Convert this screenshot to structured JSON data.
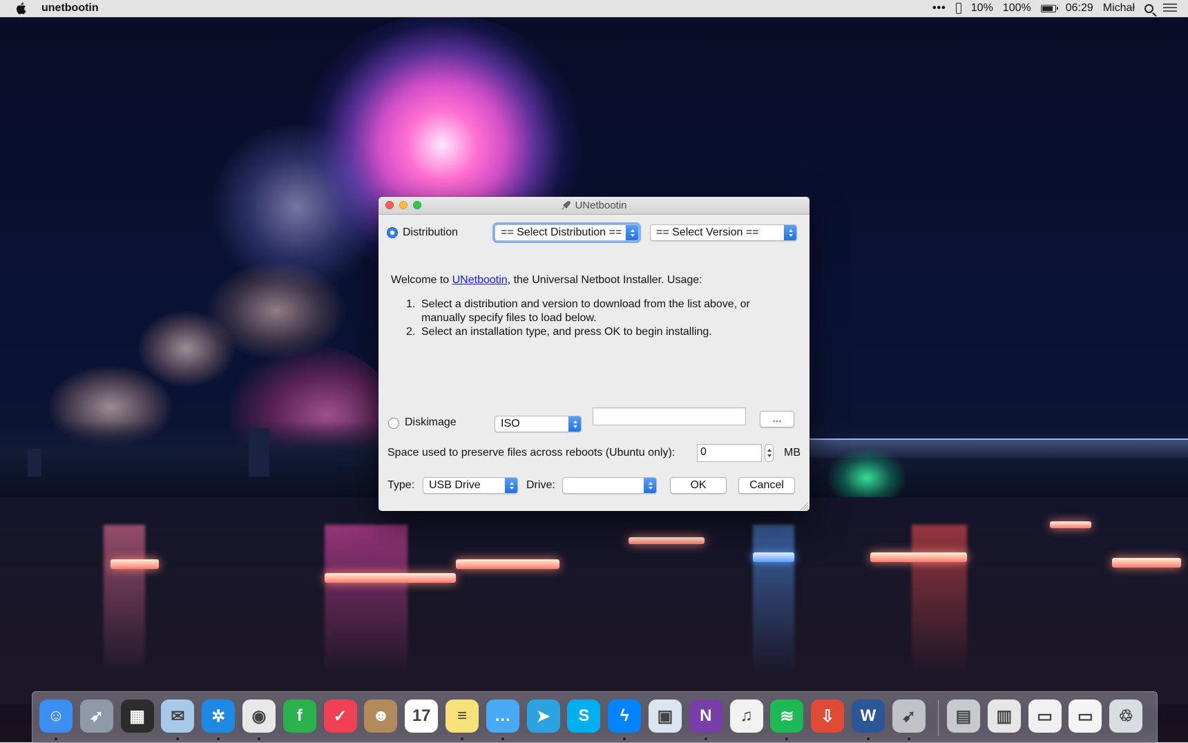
{
  "menubar": {
    "app_name": "unetbootin",
    "ellipsis": "•••",
    "phone_battery": "10%",
    "battery": "100%",
    "time": "06:29",
    "user": "Michał"
  },
  "window": {
    "title": "UNetbootin",
    "distribution_label": "Distribution",
    "select_distribution": "== Select Distribution ==",
    "select_version": "== Select Version ==",
    "welcome_prefix": "Welcome to ",
    "welcome_link": "UNetbootin",
    "welcome_suffix": ", the Universal Netboot Installer. Usage:",
    "steps": [
      {
        "num": "1.",
        "text": "Select a distribution and version to download from the list above, or manually specify files to load below."
      },
      {
        "num": "2.",
        "text": "Select an installation type, and press OK to begin installing."
      }
    ],
    "diskimage_label": "Diskimage",
    "diskimage_type": "ISO",
    "diskimage_path": "",
    "browse_label": "...",
    "space_label": "Space used to preserve files across reboots (Ubuntu only):",
    "space_value": "0",
    "space_unit": "MB",
    "type_label": "Type:",
    "type_value": "USB Drive",
    "drive_label": "Drive:",
    "drive_value": "",
    "ok_label": "OK",
    "cancel_label": "Cancel"
  },
  "dock": {
    "apps": [
      {
        "name": "finder-icon",
        "color": "#3b8ff1",
        "glyph": "☺",
        "running": true
      },
      {
        "name": "launchpad-icon",
        "color": "#8e9aa8",
        "glyph": "➶",
        "running": false
      },
      {
        "name": "mission-control-icon",
        "color": "#2c2c2c",
        "glyph": "▦",
        "running": false
      },
      {
        "name": "mail-stamp-icon",
        "color": "#a8c8e8",
        "glyph": "✉",
        "running": true
      },
      {
        "name": "safari-icon",
        "color": "#1e88e5",
        "glyph": "✲",
        "running": true
      },
      {
        "name": "chrome-icon",
        "color": "#e8e8e8",
        "glyph": "◉",
        "running": true
      },
      {
        "name": "feedly-icon",
        "color": "#2bb24c",
        "glyph": "f",
        "running": false
      },
      {
        "name": "pocket-icon",
        "color": "#ef4056",
        "glyph": "✓",
        "running": false
      },
      {
        "name": "contacts-icon",
        "color": "#b28a5b",
        "glyph": "☻",
        "running": false
      },
      {
        "name": "calendar-icon",
        "color": "#ffffff",
        "glyph": "17",
        "running": false
      },
      {
        "name": "notes-icon",
        "color": "#f7e27a",
        "glyph": "≡",
        "running": true
      },
      {
        "name": "messages-icon",
        "color": "#4aa9f5",
        "glyph": "…",
        "running": true
      },
      {
        "name": "telegram-icon",
        "color": "#2aa3e0",
        "glyph": "➤",
        "running": false
      },
      {
        "name": "skype-icon",
        "color": "#00aff0",
        "glyph": "S",
        "running": false
      },
      {
        "name": "messenger-icon",
        "color": "#0084ff",
        "glyph": "ϟ",
        "running": true
      },
      {
        "name": "preview-icon",
        "color": "#d9e6ef",
        "glyph": "▣",
        "running": false
      },
      {
        "name": "onenote-icon",
        "color": "#7a3ea8",
        "glyph": "N",
        "running": true
      },
      {
        "name": "itunes-icon",
        "color": "#f2f2f2",
        "glyph": "♫",
        "running": false
      },
      {
        "name": "spotify-icon",
        "color": "#1db954",
        "glyph": "≋",
        "running": true
      },
      {
        "name": "transmit-icon",
        "color": "#e04a36",
        "glyph": "⇩",
        "running": false
      },
      {
        "name": "word-icon",
        "color": "#2b5796",
        "glyph": "W",
        "running": true
      },
      {
        "name": "unetbootin-icon",
        "color": "#bfc3c8",
        "glyph": "➹",
        "running": true
      }
    ],
    "stacks": [
      {
        "name": "folder-stack-icon",
        "color": "#c6c9ce",
        "glyph": "▤"
      },
      {
        "name": "documents-stack-icon",
        "color": "#e6e6e6",
        "glyph": "▥"
      },
      {
        "name": "downloads-stack-icon",
        "color": "#f0f0f0",
        "glyph": "▭"
      },
      {
        "name": "desktop-stack-icon",
        "color": "#f4f4f4",
        "glyph": "▭"
      },
      {
        "name": "trash-icon",
        "color": "#d8dde2",
        "glyph": "♲"
      }
    ]
  }
}
